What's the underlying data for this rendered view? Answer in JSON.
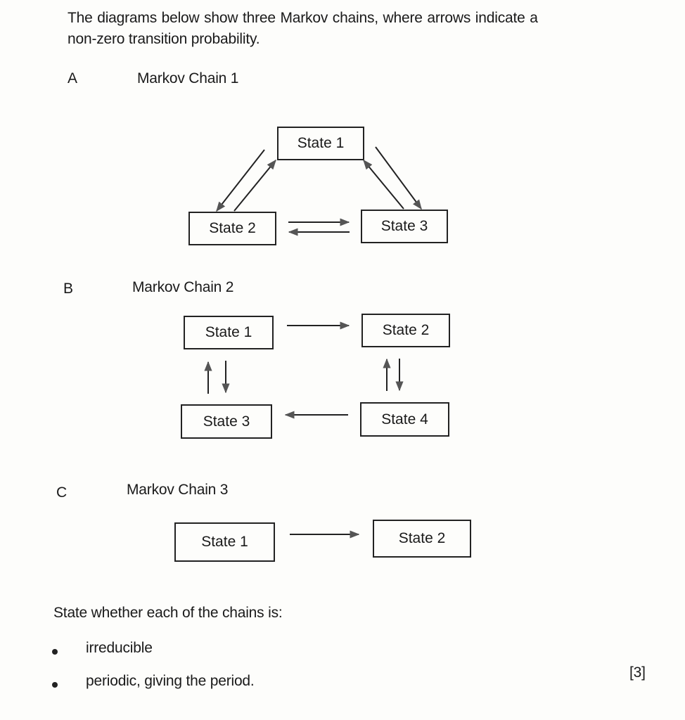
{
  "intro": {
    "line1": "The diagrams below show three Markov chains, where arrows indicate a",
    "line2": "non-zero transition probability."
  },
  "chains": [
    {
      "letter": "A",
      "title": "Markov Chain 1",
      "states": [
        "State 1",
        "State 2",
        "State 3"
      ],
      "transitions": [
        [
          "State 1",
          "State 2"
        ],
        [
          "State 2",
          "State 1"
        ],
        [
          "State 1",
          "State 3"
        ],
        [
          "State 3",
          "State 1"
        ],
        [
          "State 2",
          "State 3"
        ],
        [
          "State 3",
          "State 2"
        ]
      ]
    },
    {
      "letter": "B",
      "title": "Markov Chain 2",
      "states": [
        "State 1",
        "State 2",
        "State 3",
        "State 4"
      ],
      "transitions": [
        [
          "State 1",
          "State 2"
        ],
        [
          "State 1",
          "State 3"
        ],
        [
          "State 3",
          "State 1"
        ],
        [
          "State 2",
          "State 4"
        ],
        [
          "State 4",
          "State 2"
        ],
        [
          "State 4",
          "State 3"
        ]
      ]
    },
    {
      "letter": "C",
      "title": "Markov Chain 3",
      "states": [
        "State 1",
        "State 2"
      ],
      "transitions": [
        [
          "State 1",
          "State 2"
        ]
      ]
    }
  ],
  "question": {
    "prompt": "State whether each of the chains is:",
    "bullets": [
      "irreducible",
      "periodic, giving the period."
    ],
    "marks": "[3]"
  }
}
